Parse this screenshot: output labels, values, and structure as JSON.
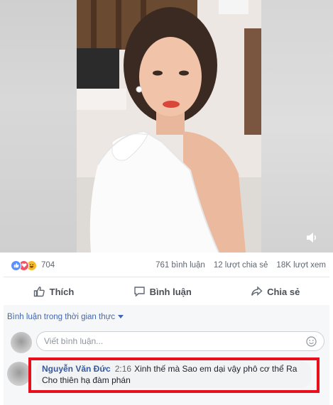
{
  "video": {
    "mute_icon": "speaker-icon"
  },
  "stats": {
    "reactions": [
      "like",
      "love",
      "haha"
    ],
    "reaction_count": "704",
    "comments": "761 bình luận",
    "shares": "12 lượt chia sẻ",
    "views": "18K lượt xem"
  },
  "actions": {
    "like_label": "Thích",
    "comment_label": "Bình luận",
    "share_label": "Chia sẻ"
  },
  "comments": {
    "filter_label": "Bình luận trong thời gian thực",
    "input_placeholder": "Viết bình luận...",
    "first": {
      "author": "Nguyễn Văn Đức",
      "time": "2:16",
      "text": "Xinh thế mà Sao em dại vậy phô cơ thể Ra Cho thiên hạ đàm phán"
    },
    "highlight_color": "#e8101d"
  }
}
